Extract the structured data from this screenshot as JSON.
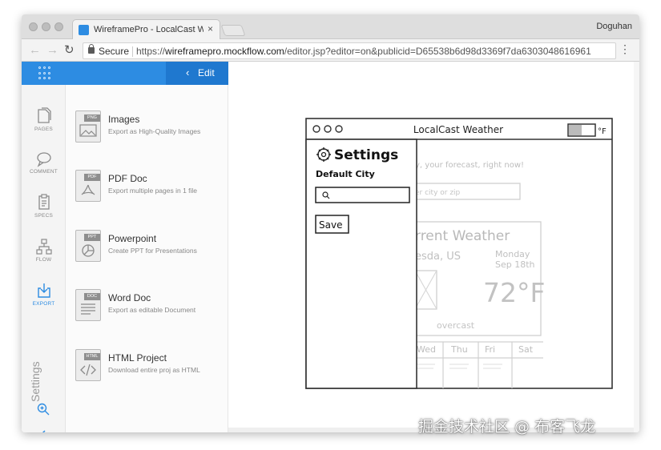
{
  "browser": {
    "tab_title": "WireframePro - LocalCast Weather",
    "tab_close": "×",
    "user": "Doguhan",
    "secure_label": "Secure",
    "url_scheme": "https://",
    "url_domain": "wireframepro.mockflow.com",
    "url_path": "/editor.jsp?editor=on&publicid=D65538b6d98d3369f7da6303048616961",
    "back_icon": "arrow-left-icon",
    "forward_icon": "arrow-right-icon",
    "reload_icon": "reload-icon",
    "menu_icon": "kebab-menu-icon"
  },
  "header": {
    "grid_icon": "app-grid-icon",
    "edit_label": "Edit",
    "edit_chevron": "‹",
    "color": "#2d8ce2"
  },
  "iconbar": {
    "items": [
      {
        "label": "PAGES",
        "icon": "pages-icon"
      },
      {
        "label": "COMMENT",
        "icon": "comment-icon"
      },
      {
        "label": "SPECS",
        "icon": "specs-icon"
      },
      {
        "label": "FLOW",
        "icon": "flow-icon"
      },
      {
        "label": "EXPORT",
        "icon": "export-icon",
        "active": true
      }
    ],
    "settings_label": "Settings",
    "zoom_icon": "zoom-in-icon",
    "collapse_icon": "chevron-left-icon"
  },
  "export": {
    "items": [
      {
        "badge": "PNG",
        "title": "Images",
        "desc": "Export as High-Quality Images",
        "icon": "image-icon"
      },
      {
        "badge": "PDF",
        "title": "PDF Doc",
        "desc": "Export multiple pages in 1 file",
        "icon": "pdf-icon"
      },
      {
        "badge": "PPT",
        "title": "Powerpoint",
        "desc": "Create PPT for Presentations",
        "icon": "pie-chart-icon"
      },
      {
        "badge": "DOC",
        "title": "Word Doc",
        "desc": "Export as editable Document",
        "icon": "text-lines-icon"
      },
      {
        "badge": "HTML",
        "title": "HTML Project",
        "desc": "Download entire proj as HTML",
        "icon": "code-icon"
      }
    ]
  },
  "wireframe": {
    "app_title": "LocalCast Weather",
    "unit_toggle": "°F",
    "settings_title": "Settings",
    "default_city_label": "Default City",
    "save_label": "Save",
    "tagline": "y, your forecast, right now!",
    "city_placeholder": "er city or zip",
    "current_weather": "rrent Weather",
    "location": "esda, US",
    "day": "Monday",
    "date": "Sep 18th",
    "temperature": "72°F",
    "condition": "overcast",
    "forecast_days": [
      "Wed",
      "Thu",
      "Fri",
      "Sat"
    ]
  },
  "watermark": "掘金技术社区 @ 布客飞龙"
}
